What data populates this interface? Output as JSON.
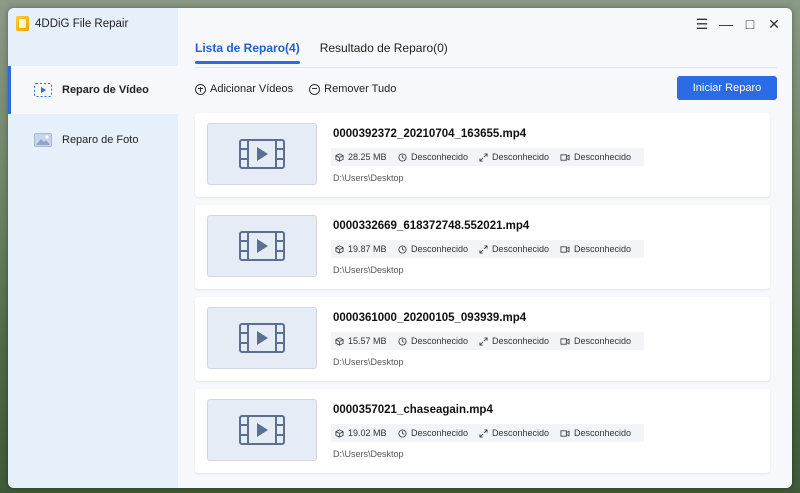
{
  "app": {
    "title": "4DDiG File Repair"
  },
  "window_controls": {
    "menu": "☰",
    "minimize": "—",
    "maximize": "□",
    "close": "✕"
  },
  "sidebar": {
    "items": [
      {
        "label": "Reparo de Vídeo",
        "icon": "video-repair-icon",
        "active": true
      },
      {
        "label": "Reparo de Foto",
        "icon": "photo-repair-icon",
        "active": false
      }
    ]
  },
  "tabs": [
    {
      "label": "Lista de Reparo(4)",
      "active": true
    },
    {
      "label": "Resultado de Reparo(0)",
      "active": false
    }
  ],
  "toolbar": {
    "add_label": "Adicionar Vídeos",
    "remove_label": "Remover Tudo",
    "start_label": "Iniciar Reparo"
  },
  "colors": {
    "accent": "#2b6be6",
    "sidebar_bg": "#e6f0fb"
  },
  "files": [
    {
      "name": "0000392372_20210704_163655.mp4",
      "size": "28.25 MB",
      "duration": "Desconhecido",
      "resolution": "Desconhecido",
      "codec": "Desconhecido",
      "path": "D:\\Users\\Desktop"
    },
    {
      "name": "0000332669_618372748.552021.mp4",
      "size": "19.87 MB",
      "duration": "Desconhecido",
      "resolution": "Desconhecido",
      "codec": "Desconhecido",
      "path": "D:\\Users\\Desktop"
    },
    {
      "name": "0000361000_20200105_093939.mp4",
      "size": "15.57 MB",
      "duration": "Desconhecido",
      "resolution": "Desconhecido",
      "codec": "Desconhecido",
      "path": "D:\\Users\\Desktop"
    },
    {
      "name": "0000357021_chaseagain.mp4",
      "size": "19.02 MB",
      "duration": "Desconhecido",
      "resolution": "Desconhecido",
      "codec": "Desconhecido",
      "path": "D:\\Users\\Desktop"
    }
  ]
}
